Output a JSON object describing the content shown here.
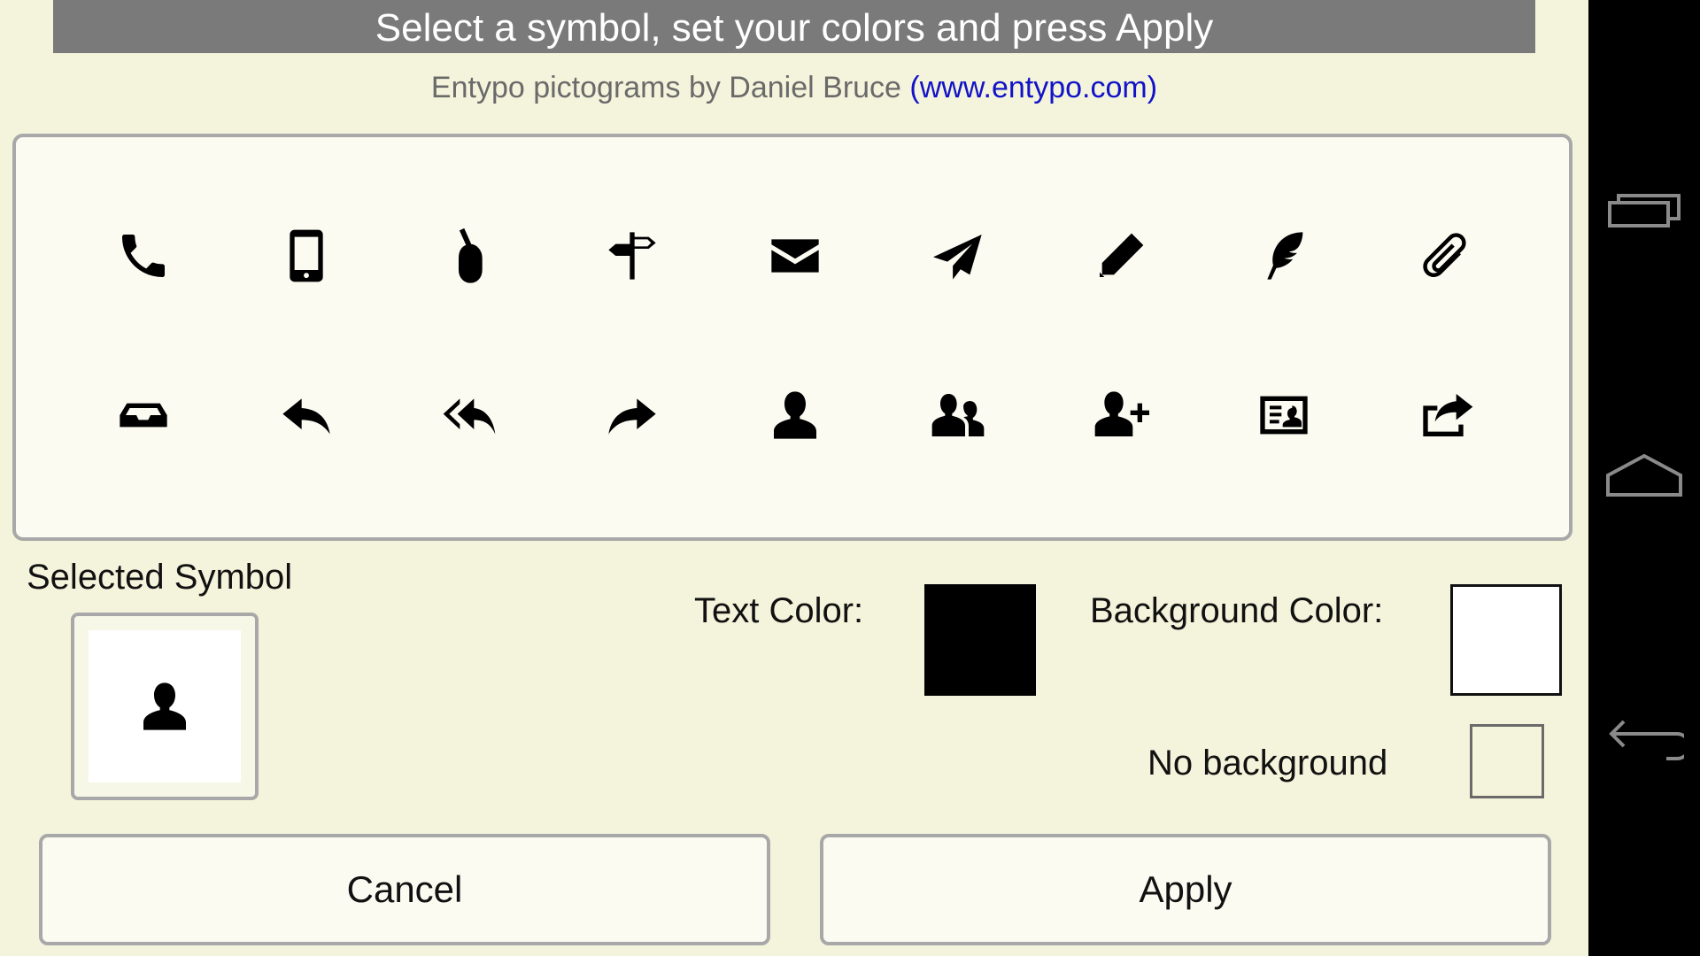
{
  "header": {
    "title": "Select a symbol, set your colors and press Apply"
  },
  "credit": {
    "text": "Entypo pictograms by Daniel Bruce",
    "link": "(www.entypo.com)"
  },
  "symbols": {
    "row1": [
      "phone-icon",
      "mobile-icon",
      "mouse-icon",
      "signpost-icon",
      "mail-icon",
      "paper-plane-icon",
      "pencil-icon",
      "feather-icon",
      "paperclip-icon"
    ],
    "row2": [
      "inbox-icon",
      "reply-icon",
      "reply-all-icon",
      "forward-icon",
      "user-icon",
      "users-icon",
      "add-user-icon",
      "vcard-icon",
      "export-icon"
    ]
  },
  "selected": {
    "label": "Selected Symbol",
    "icon": "user-icon"
  },
  "colors": {
    "text_label": "Text Color:",
    "text_value": "#000000",
    "background_label": "Background Color:",
    "background_value": "#ffffff"
  },
  "no_background": {
    "label": "No background",
    "checked": false
  },
  "buttons": {
    "cancel": "Cancel",
    "apply": "Apply"
  },
  "navbar": [
    "recent-apps-icon",
    "home-icon",
    "back-icon"
  ]
}
